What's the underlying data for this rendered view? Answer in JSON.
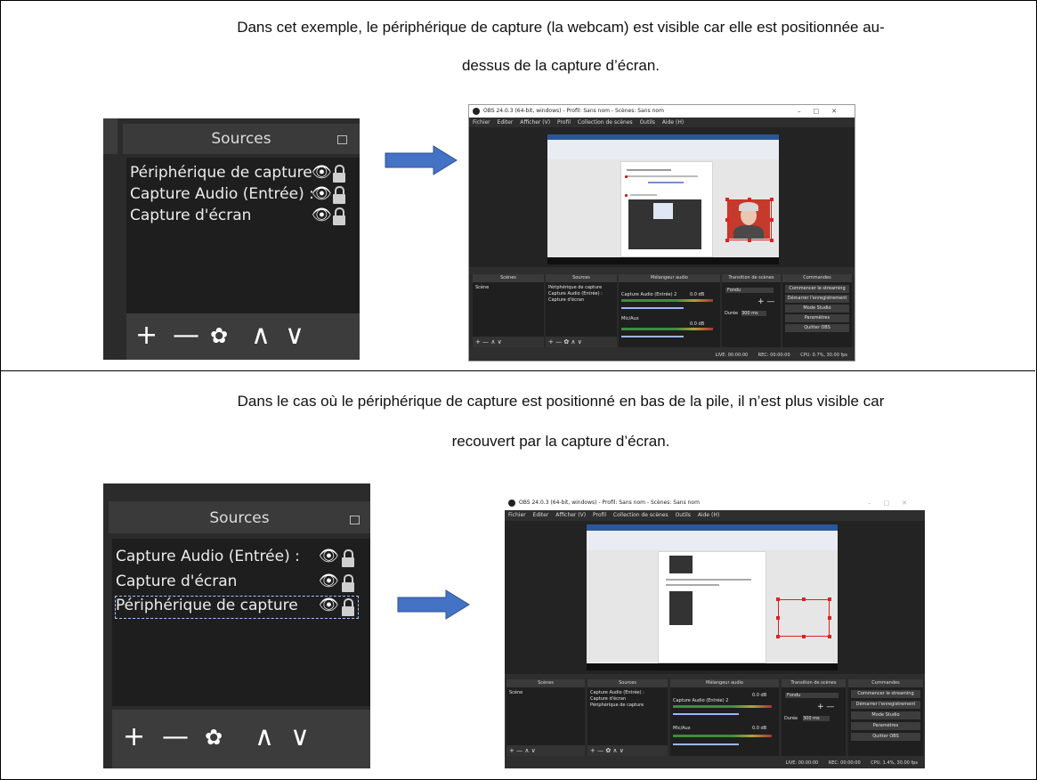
{
  "document": {
    "paragraph1_line1": "Dans cet exemple, le périphérique de capture (la webcam) est visible car elle est positionnée au-",
    "paragraph1_line2": "dessus de la capture d’écran.",
    "paragraph2_line1": "Dans le cas où le périphérique de capture est positionné en bas de la pile, il n’est plus visible car",
    "paragraph2_line2": "recouvert par la capture d’écran."
  },
  "panel1": {
    "title": "Sources",
    "items": [
      "Périphérique de capture",
      "Capture Audio (Entrée) :",
      "Capture d'écran"
    ]
  },
  "panel2": {
    "title": "Sources",
    "items": [
      "Capture Audio (Entrée) :",
      "Capture d'écran",
      "Périphérique de capture"
    ]
  },
  "toolbar": {
    "add": "+",
    "remove": "—",
    "settings": "✿",
    "up": "∧",
    "down": "∨"
  },
  "obs": {
    "window_title": "OBS 24.0.3 (64-bit, windows) - Profil: Sans nom - Scènes: Sans nom",
    "menu": [
      "Fichier",
      "Editer",
      "Afficher (V)",
      "Profil",
      "Collection de scènes",
      "Outils",
      "Aide (H)"
    ],
    "docks": {
      "scenes": "Scènes",
      "sources": "Sources",
      "mixer": "Mélangeur audio",
      "transitions": "Transition de scènes",
      "controls": "Commandes"
    },
    "scene_item": "Scène",
    "mixer_track1": "Capture Audio (Entrée) 2",
    "mixer_track1_db": "0.0 dB",
    "mixer_track2": "Mic/Aux",
    "mixer_track2_db": "0.0 dB",
    "transition": "Fondu",
    "duration_label": "Durée",
    "duration_value": "300 ms",
    "controls": [
      "Commencer le streaming",
      "Démarrer l'enregistrement",
      "Mode Studio",
      "Paramètres",
      "Quitter OBS"
    ],
    "status": {
      "live": "LIVE: 00:00:00",
      "rec": "REC: 00:00:00",
      "cpu1": "CPU: 0.7%, 30.00 fps",
      "cpu2": "CPU: 1.4%, 30.00 fps"
    }
  },
  "colors": {
    "obs_dark": "#2e2e2e",
    "arrow_blue": "#4472c4",
    "highlight_red": "#e02020"
  }
}
